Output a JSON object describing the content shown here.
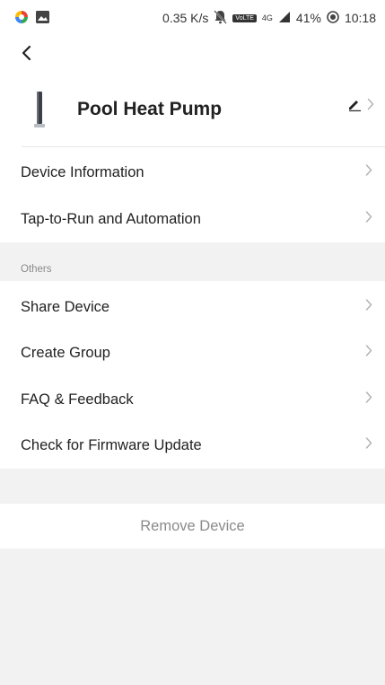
{
  "status_bar": {
    "speed": "0.35 K/s",
    "network_badge": "VoLTE",
    "network_type": "4G",
    "battery": "41%",
    "time": "10:18",
    "icons": [
      "app-notification-icon",
      "image-notification-icon",
      "mute-icon",
      "signal-icon",
      "battery-saver-icon"
    ]
  },
  "header": {
    "back_icon": "chevron-left-icon",
    "device_name": "Pool Heat Pump",
    "edit_icon": "pencil-icon"
  },
  "menu_top": [
    {
      "label": "Device Information"
    },
    {
      "label": "Tap-to-Run and Automation"
    }
  ],
  "others": {
    "section_label": "Others",
    "items": [
      {
        "label": "Share Device"
      },
      {
        "label": "Create Group"
      },
      {
        "label": "FAQ & Feedback"
      },
      {
        "label": "Check for Firmware Update"
      }
    ]
  },
  "remove": {
    "label": "Remove Device"
  },
  "colors": {
    "background": "#f2f2f2",
    "surface": "#ffffff",
    "primary_text": "#222222",
    "secondary_text": "#8a8a8a",
    "chevron": "#b3b3b3"
  }
}
